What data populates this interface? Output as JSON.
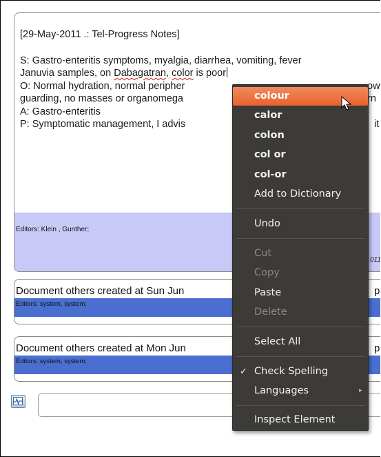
{
  "note": {
    "title": "[29-May-2011 .: Tel-Progress Notes]",
    "subjective_before": "S: Gastro-enteritis symptoms, myalgia, diarrhea, vomiting, fever",
    "line2_before": "Januvia samples, on ",
    "line2_misspelled": "Dabagatran",
    "line2_middle": ", ",
    "line2_highlight": "color",
    "line2_after": " is poor",
    "objective": "O: Normal hydration, normal peripher",
    "objective_tail": "ow",
    "line4": "guarding, no masses or organomega",
    "line4_tail": "rn",
    "assessment": "A: Gastro-enteritis",
    "plan": "P: Symptomatic management, I advis",
    "plan_tail": "it s",
    "editors": "Editors:   Klein , Gunther;",
    "date_fragment": "011"
  },
  "docs": [
    {
      "title": "Document others created at Sun Jun",
      "right_fragment": "py",
      "editors": "Editors:   system, system;"
    },
    {
      "title": "Document others created at Mon Jun",
      "right_fragment": "py",
      "editors": "Editors:   system, system;"
    }
  ],
  "input": {
    "placeholder": ""
  },
  "context_menu": {
    "suggestions": [
      "colour",
      "calor",
      "colon",
      "col or",
      "col-or"
    ],
    "add_to_dictionary": "Add to Dictionary",
    "undo": "Undo",
    "cut": "Cut",
    "copy": "Copy",
    "paste": "Paste",
    "delete": "Delete",
    "select_all": "Select All",
    "check_spelling": "Check Spelling",
    "languages": "Languages",
    "inspect_element": "Inspect Element"
  },
  "colors": {
    "menu_bg": "#3c3b37",
    "menu_highlight": "#e8622d",
    "editors_band": "#c9c9f7",
    "doc_band": "#4a6fd0"
  },
  "icons": {
    "check": "check-icon",
    "submenu": "chevron-right-icon",
    "cursor": "mouse-pointer-icon"
  }
}
